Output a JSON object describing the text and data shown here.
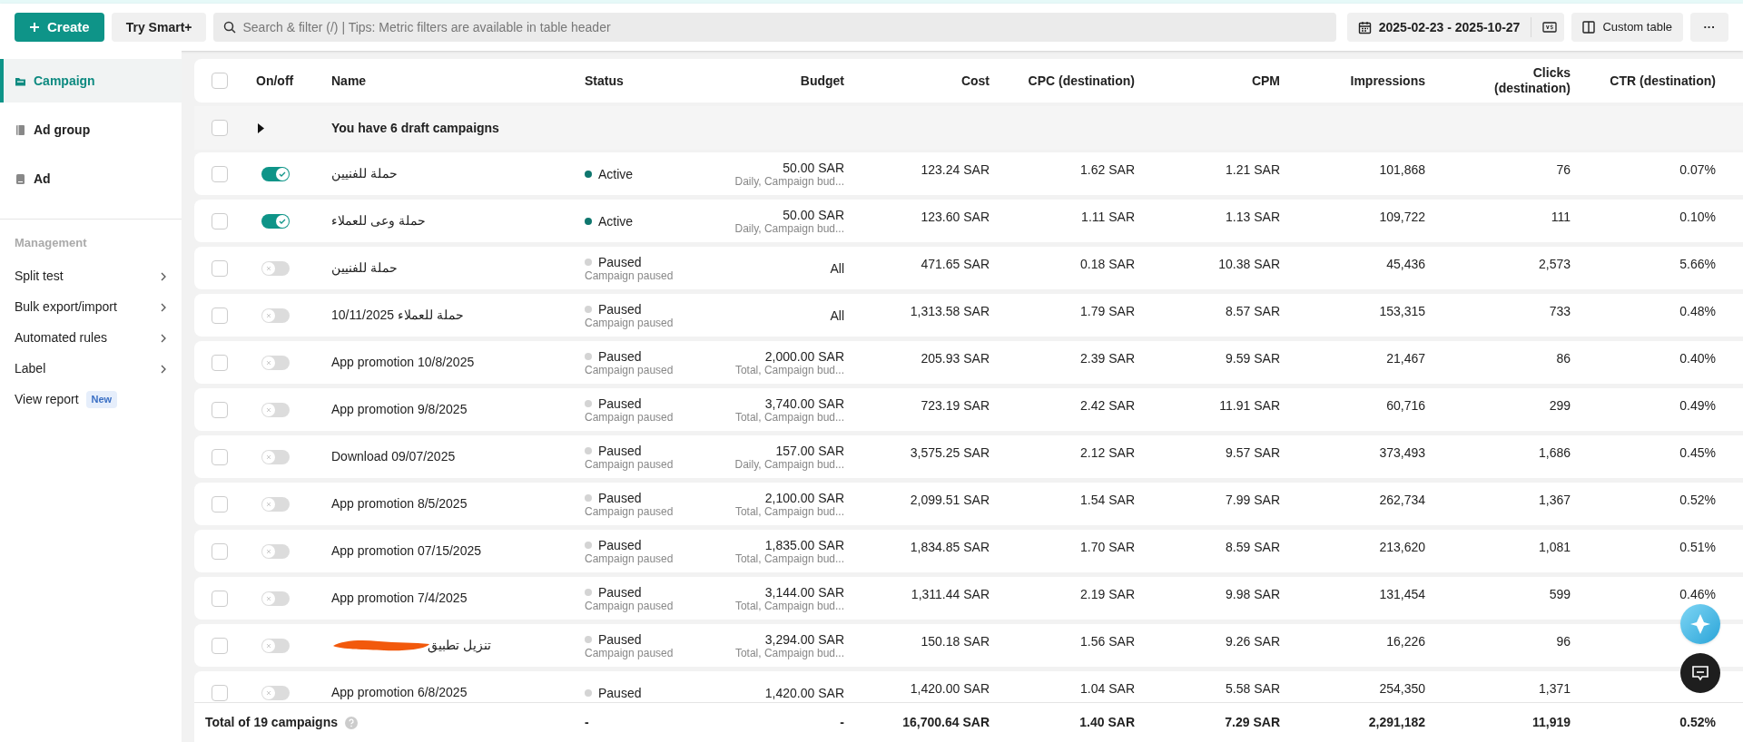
{
  "toolbar": {
    "create": "Create",
    "smart": "Try Smart+",
    "search": {
      "placeholder": "Search & filter (/) | Tips: Metric filters are available in table header"
    },
    "date_range": "2025-02-23 - 2025-10-27",
    "custom_table": "Custom table",
    "more": "···"
  },
  "sidebar": {
    "levels": [
      {
        "label": "Campaign",
        "selected": true,
        "kind": "folder"
      },
      {
        "label": "Ad group",
        "selected": false,
        "kind": "stack"
      },
      {
        "label": "Ad",
        "selected": false,
        "kind": "card"
      }
    ],
    "section": "Management",
    "items": [
      {
        "label": "Split test",
        "kind": "chevron"
      },
      {
        "label": "Bulk export/import",
        "kind": "chevron"
      },
      {
        "label": "Automated rules",
        "kind": "chevron"
      },
      {
        "label": "Label",
        "kind": "chevron"
      },
      {
        "label": "View report",
        "kind": "badge",
        "badge": "New"
      }
    ]
  },
  "table": {
    "columns": [
      "On/off",
      "Name",
      "Status",
      "Budget",
      "Cost",
      "CPC (destination)",
      "CPM",
      "Impressions",
      "Clicks (destination)",
      "CTR (destination)"
    ],
    "select_all_checked": false,
    "draft_row": "You have 6 draft campaigns",
    "draft_checked": false,
    "rows": [
      {
        "checked": false,
        "on": true,
        "name": "حملة للفنيين",
        "status": {
          "kind": "active",
          "label": "Active"
        },
        "budget": {
          "amount": "50.00 SAR",
          "note": "Daily, Campaign bud..."
        },
        "cost": "123.24 SAR",
        "cpc": "1.62 SAR",
        "cpm": "1.21 SAR",
        "impressions": "101,868",
        "clicks": "76",
        "ctr": "0.07%"
      },
      {
        "checked": false,
        "on": true,
        "name": "حملة وعى للعملاء",
        "status": {
          "kind": "active",
          "label": "Active"
        },
        "budget": {
          "amount": "50.00 SAR",
          "note": "Daily, Campaign bud..."
        },
        "cost": "123.60 SAR",
        "cpc": "1.11 SAR",
        "cpm": "1.13 SAR",
        "impressions": "109,722",
        "clicks": "111",
        "ctr": "0.10%"
      },
      {
        "checked": false,
        "on": false,
        "name": "حملة للفنيين",
        "status": {
          "kind": "paused",
          "label": "Paused",
          "sub": "Campaign paused"
        },
        "budget": {
          "amount": "All"
        },
        "cost": "471.65 SAR",
        "cpc": "0.18 SAR",
        "cpm": "10.38 SAR",
        "impressions": "45,436",
        "clicks": "2,573",
        "ctr": "5.66%"
      },
      {
        "checked": false,
        "on": false,
        "name": "حملة للعملاء 10/11/2025",
        "status": {
          "kind": "paused",
          "label": "Paused",
          "sub": "Campaign paused"
        },
        "budget": {
          "amount": "All"
        },
        "cost": "1,313.58 SAR",
        "cpc": "1.79 SAR",
        "cpm": "8.57 SAR",
        "impressions": "153,315",
        "clicks": "733",
        "ctr": "0.48%"
      },
      {
        "checked": false,
        "on": false,
        "name": "App promotion 10/8/2025",
        "status": {
          "kind": "paused",
          "label": "Paused",
          "sub": "Campaign paused"
        },
        "budget": {
          "amount": "2,000.00 SAR",
          "note": "Total, Campaign bud..."
        },
        "cost": "205.93 SAR",
        "cpc": "2.39 SAR",
        "cpm": "9.59 SAR",
        "impressions": "21,467",
        "clicks": "86",
        "ctr": "0.40%"
      },
      {
        "checked": false,
        "on": false,
        "name": "App promotion 9/8/2025",
        "status": {
          "kind": "paused",
          "label": "Paused",
          "sub": "Campaign paused"
        },
        "budget": {
          "amount": "3,740.00 SAR",
          "note": "Total, Campaign bud..."
        },
        "cost": "723.19 SAR",
        "cpc": "2.42 SAR",
        "cpm": "11.91 SAR",
        "impressions": "60,716",
        "clicks": "299",
        "ctr": "0.49%"
      },
      {
        "checked": false,
        "on": false,
        "name": "Download 09/07/2025",
        "status": {
          "kind": "paused",
          "label": "Paused",
          "sub": "Campaign paused"
        },
        "budget": {
          "amount": "157.00 SAR",
          "note": "Daily, Campaign bud..."
        },
        "cost": "3,575.25 SAR",
        "cpc": "2.12 SAR",
        "cpm": "9.57 SAR",
        "impressions": "373,493",
        "clicks": "1,686",
        "ctr": "0.45%"
      },
      {
        "checked": false,
        "on": false,
        "name": "App promotion 8/5/2025",
        "status": {
          "kind": "paused",
          "label": "Paused",
          "sub": "Campaign paused"
        },
        "budget": {
          "amount": "2,100.00 SAR",
          "note": "Total, Campaign bud..."
        },
        "cost": "2,099.51 SAR",
        "cpc": "1.54 SAR",
        "cpm": "7.99 SAR",
        "impressions": "262,734",
        "clicks": "1,367",
        "ctr": "0.52%"
      },
      {
        "checked": false,
        "on": false,
        "name": "App promotion 07/15/2025",
        "status": {
          "kind": "paused",
          "label": "Paused",
          "sub": "Campaign paused"
        },
        "budget": {
          "amount": "1,835.00 SAR",
          "note": "Total, Campaign bud..."
        },
        "cost": "1,834.85 SAR",
        "cpc": "1.70 SAR",
        "cpm": "8.59 SAR",
        "impressions": "213,620",
        "clicks": "1,081",
        "ctr": "0.51%"
      },
      {
        "checked": false,
        "on": false,
        "name": "App promotion 7/4/2025",
        "status": {
          "kind": "paused",
          "label": "Paused",
          "sub": "Campaign paused"
        },
        "budget": {
          "amount": "3,144.00 SAR",
          "note": "Total, Campaign bud..."
        },
        "cost": "1,311.44 SAR",
        "cpc": "2.19 SAR",
        "cpm": "9.98 SAR",
        "impressions": "131,454",
        "clicks": "599",
        "ctr": "0.46%"
      },
      {
        "checked": false,
        "on": false,
        "name": "تنزيل تطبيق",
        "redacted": true,
        "status": {
          "kind": "paused",
          "label": "Paused",
          "sub": "Campaign paused"
        },
        "budget": {
          "amount": "3,294.00 SAR",
          "note": "Total, Campaign bud..."
        },
        "cost": "150.18 SAR",
        "cpc": "1.56 SAR",
        "cpm": "9.26 SAR",
        "impressions": "16,226",
        "clicks": "96"
      },
      {
        "checked": false,
        "on": false,
        "name": "App promotion 6/8/2025",
        "status": {
          "kind": "paused",
          "label": "Paused"
        },
        "budget": {
          "amount": "1,420.00 SAR"
        },
        "cost": "1,420.00 SAR",
        "cpc": "1.04 SAR",
        "cpm": "5.58 SAR",
        "impressions": "254,350",
        "clicks": "1,371"
      }
    ],
    "total": {
      "label": "Total of 19 campaigns",
      "status": "-",
      "budget": "-",
      "cost": "16,700.64 SAR",
      "cpc": "1.40 SAR",
      "cpm": "7.29 SAR",
      "impressions": "2,291,182",
      "clicks": "11,919",
      "ctr": "0.52%"
    }
  }
}
